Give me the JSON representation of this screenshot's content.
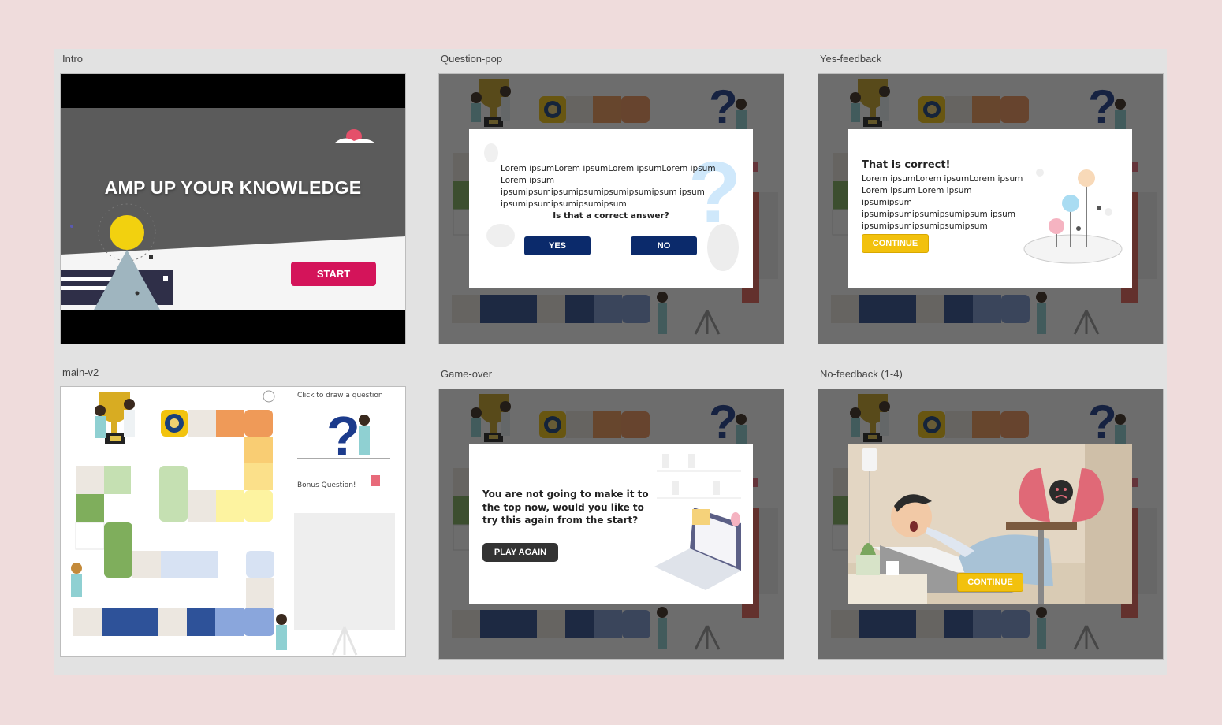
{
  "frames": {
    "intro": {
      "label": "Intro",
      "title": "AMP UP YOUR KNOWLEDGE",
      "start_label": "START"
    },
    "question_pop": {
      "label": "Question-pop",
      "body": "Lorem ipsumLorem ipsumLorem ipsumLorem ipsum Lorem ipsum ipsumipsumipsumipsumipsumipsumipsum ipsum ipsumipsumipsumipsumipsum",
      "question": "Is that a correct answer?",
      "yes_label": "YES",
      "no_label": "NO"
    },
    "yes_feedback": {
      "label": "Yes-feedback",
      "heading": "That is correct!",
      "body": "Lorem ipsumLorem ipsumLorem ipsum Lorem ipsum Lorem ipsum ipsumipsum ipsumipsumipsumipsumipsum ipsum ipsumipsumipsumipsumipsum",
      "continue_label": "CONTINUE"
    },
    "main_v2": {
      "label": "main-v2",
      "draw_hint": "Click to draw a question",
      "bonus_label": "Bonus Question!"
    },
    "game_over": {
      "label": "Game-over",
      "message": "You are not going to make it to the top now, would you like to try this again from the start?",
      "play_again_label": "PLAY AGAIN"
    },
    "no_feedback": {
      "label": "No-feedback (1-4)",
      "continue_label": "CONTINUE"
    }
  },
  "colors": {
    "background": "#efdcdc",
    "canvas": "#e2e2e2",
    "start_button": "#d4145a",
    "yes_no_button": "#0b2a6b",
    "continue_button": "#f2c10d",
    "play_again_button": "#333333"
  }
}
